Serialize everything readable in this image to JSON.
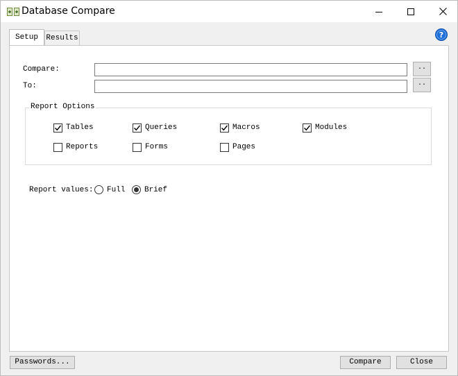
{
  "window": {
    "title": "Database Compare",
    "controls": [
      "minimize-icon",
      "maximize-icon",
      "close-icon"
    ]
  },
  "tabs": [
    {
      "label": "Setup",
      "active": true
    },
    {
      "label": "Results",
      "active": false
    }
  ],
  "setup": {
    "compare_label": "Compare:",
    "compare_value": "",
    "to_label": "To:",
    "to_value": "",
    "browse_label": "..",
    "report_options": {
      "title": "Report Options",
      "items": [
        {
          "label": "Tables",
          "checked": true
        },
        {
          "label": "Queries",
          "checked": true
        },
        {
          "label": "Macros",
          "checked": true
        },
        {
          "label": "Modules",
          "checked": true
        },
        {
          "label": "Reports",
          "checked": false
        },
        {
          "label": "Forms",
          "checked": false
        },
        {
          "label": "Pages",
          "checked": false
        }
      ]
    },
    "report_values": {
      "label": "Report values:",
      "options": [
        {
          "label": "Full",
          "selected": false
        },
        {
          "label": "Brief",
          "selected": true
        }
      ]
    }
  },
  "footer": {
    "passwords_label": "Passwords...",
    "compare_label": "Compare",
    "close_label": "Close"
  },
  "colors": {
    "window_bg": "#f0f0f0",
    "panel_bg": "#ffffff",
    "help_blue": "#1e6fd9",
    "icon_green": "#6a8e3c"
  }
}
